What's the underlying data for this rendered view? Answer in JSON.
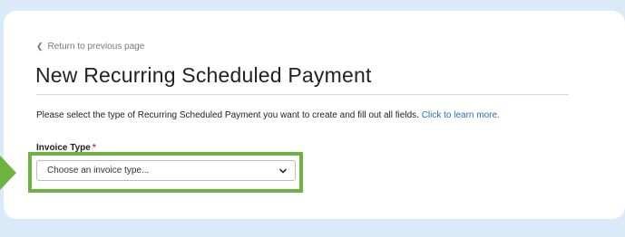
{
  "nav": {
    "back_label": "Return to previous page"
  },
  "page": {
    "title": "New Recurring Scheduled Payment",
    "instructions": "Please select the type of Recurring Scheduled Payment you want to create and fill out all fields.",
    "learn_more": "Click to learn more."
  },
  "form": {
    "invoice_type": {
      "label": "Invoice Type",
      "required_marker": "*",
      "selected": "Choose an invoice type..."
    }
  },
  "icons": {
    "back": "chevron-left-icon",
    "dropdown": "chevron-down-icon",
    "pointer": "arrow-marker"
  },
  "colors": {
    "background": "#dbeaf8",
    "highlight": "#6db33f",
    "link": "#2a6fb5",
    "required": "#d0342c"
  }
}
